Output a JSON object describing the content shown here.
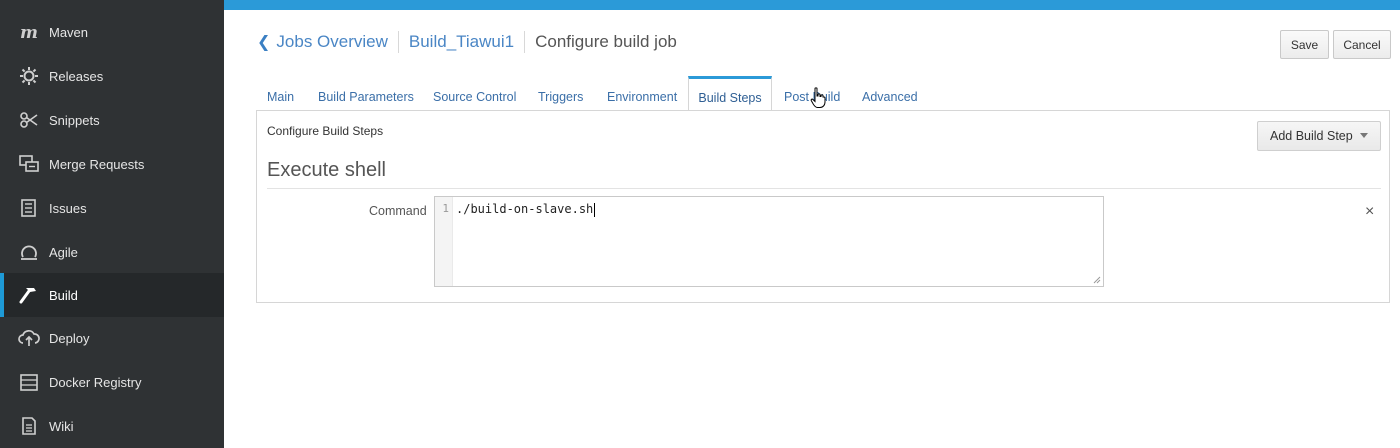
{
  "sidebar": {
    "items": [
      {
        "label": "Maven",
        "icon": "maven-icon",
        "active": false
      },
      {
        "label": "Releases",
        "icon": "releases-icon",
        "active": false
      },
      {
        "label": "Snippets",
        "icon": "snippets-icon",
        "active": false
      },
      {
        "label": "Merge Requests",
        "icon": "merge-requests-icon",
        "active": false
      },
      {
        "label": "Issues",
        "icon": "issues-icon",
        "active": false
      },
      {
        "label": "Agile",
        "icon": "agile-icon",
        "active": false
      },
      {
        "label": "Build",
        "icon": "build-hammer-icon",
        "active": true
      },
      {
        "label": "Deploy",
        "icon": "deploy-cloud-icon",
        "active": false
      },
      {
        "label": "Docker Registry",
        "icon": "docker-registry-icon",
        "active": false
      },
      {
        "label": "Wiki",
        "icon": "wiki-icon",
        "active": false
      }
    ]
  },
  "breadcrumb": {
    "back_label": "Jobs Overview",
    "job_name": "Build_Tiawui1",
    "current": "Configure build job"
  },
  "actions": {
    "save_label": "Save",
    "cancel_label": "Cancel"
  },
  "tabs": [
    {
      "label": "Main"
    },
    {
      "label": "Build Parameters"
    },
    {
      "label": "Source Control"
    },
    {
      "label": "Triggers"
    },
    {
      "label": "Environment"
    },
    {
      "label": "Build Steps",
      "active": true
    },
    {
      "label": "Post Build"
    },
    {
      "label": "Advanced"
    }
  ],
  "panel": {
    "title": "Configure Build Steps",
    "add_step_label": "Add Build Step",
    "step_title": "Execute shell",
    "command_label": "Command",
    "line_number": "1",
    "command_value": "./build-on-slave.sh",
    "remove_symbol": "×"
  },
  "colors": {
    "accent": "#2b9ad8",
    "sidebar_bg": "#2f3234",
    "link": "#4a86c5"
  }
}
